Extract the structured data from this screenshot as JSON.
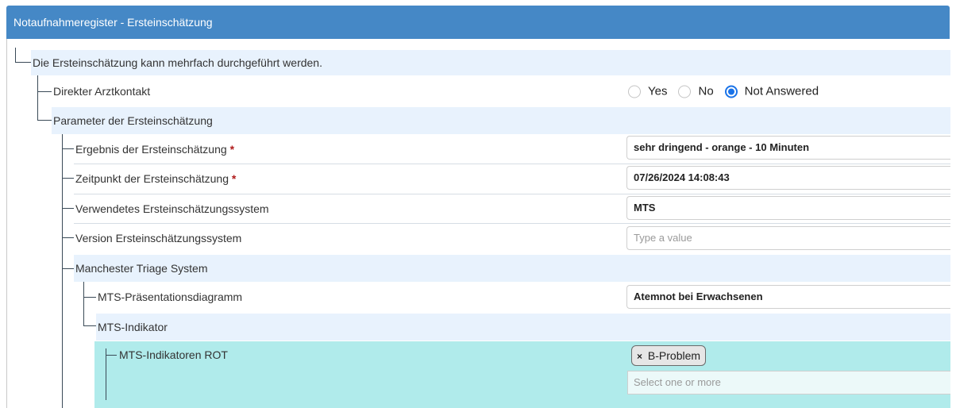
{
  "header": {
    "title": "Notaufnahmeregister - Ersteinschätzung"
  },
  "tree": {
    "root_label": "Die Ersteinschätzung kann mehrfach durchgeführt werden.",
    "direct_contact": {
      "label": "Direkter Arztkontakt",
      "options": [
        "Yes",
        "No",
        "Not Answered"
      ],
      "selected": "Not Answered"
    },
    "params": {
      "label": "Parameter der Ersteinschätzung",
      "result": {
        "label": "Ergebnis der Ersteinschätzung",
        "required_mark": "*",
        "value": "sehr dringend - orange - 10 Minuten"
      },
      "time": {
        "label": "Zeitpunkt der Ersteinschätzung",
        "required_mark": "*",
        "value": "07/26/2024 14:08:43"
      },
      "system": {
        "label": "Verwendetes Ersteinschätzungssystem",
        "value": "MTS"
      },
      "version": {
        "label": "Version Ersteinschätzungssystem",
        "value": "",
        "placeholder": "Type a value"
      },
      "mts": {
        "label": "Manchester Triage System",
        "diagram": {
          "label": "MTS-Präsentationsdiagramm",
          "value": "Atemnot bei Erwachsenen"
        },
        "indicator": {
          "label": "MTS-Indikator",
          "rot": {
            "label": "MTS-Indikatoren ROT",
            "chip_remove": "×",
            "selected": [
              "B-Problem"
            ],
            "placeholder": "Select one or more"
          }
        }
      }
    }
  },
  "colors": {
    "header": "#4588c6",
    "band": "#e8f2fd",
    "highlight": "#b0ebeb",
    "radio_selected": "#1a73e8",
    "required": "#b01c1c"
  }
}
